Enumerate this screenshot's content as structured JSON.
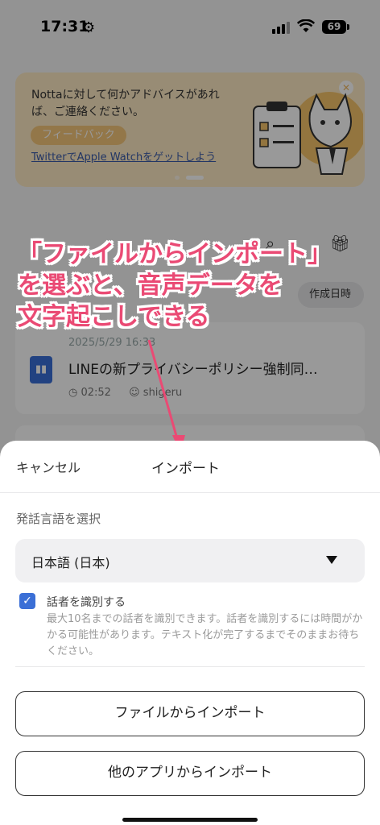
{
  "status_bar": {
    "time": "17:31",
    "battery": "69"
  },
  "banner": {
    "message": "Nottaに対して何かアドバイスがあれば、ご連絡ください。",
    "feedback_label": "フィードバック",
    "promo_link": "TwitterでApple Watchをゲットしよう"
  },
  "background": {
    "sort_label": "作成日時",
    "card": {
      "date": "2025/5/29 16:33",
      "title": "LINEの新プライバシーポリシー強制同…",
      "duration": "02:52",
      "owner": "shigeru"
    }
  },
  "annotation": {
    "line1": "「ファイルからインポート」",
    "line2": "を選ぶと、音声データを",
    "line3": "文字起こしできる",
    "color": "#ea4a74"
  },
  "sheet": {
    "cancel_label": "キャンセル",
    "title": "インポート",
    "language_label": "発話言語を選択",
    "language_value": "日本語 (日本)",
    "speaker_checked": true,
    "speaker_label": "話者を識別する",
    "speaker_desc": "最大10名までの話者を識別できます。話者を識別するには時間がかかる可能性があります。テキスト化が完了するまでそのままお待ちください。",
    "import_file_label": "ファイルからインポート",
    "import_other_label": "他のアプリからインポート"
  },
  "colors": {
    "accent": "#3b6fd6",
    "dim_overlay": "rgba(0,0,0,0.40)"
  }
}
